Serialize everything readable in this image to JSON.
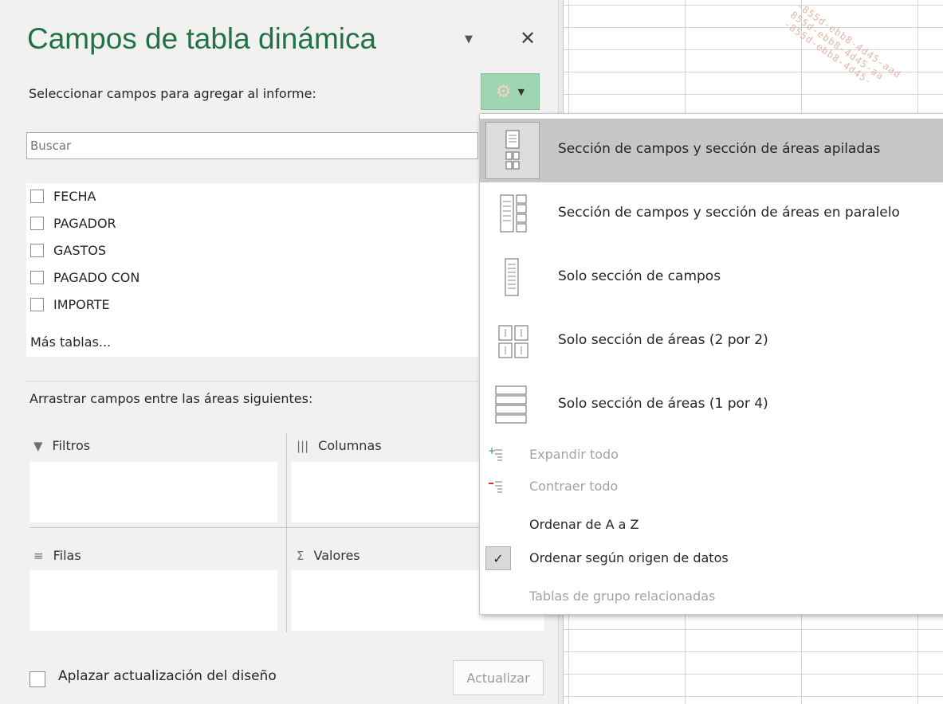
{
  "pane": {
    "title": "Campos de tabla dinámica",
    "select_label": "Seleccionar campos para agregar al informe:",
    "search_placeholder": "Buscar",
    "fields": [
      "FECHA",
      "PAGADOR",
      "GASTOS",
      "PAGADO CON",
      "IMPORTE"
    ],
    "more_tables": "Más tablas...",
    "drag_label": "Arrastrar campos entre las áreas siguientes:",
    "areas": {
      "filters": "Filtros",
      "columns": "Columnas",
      "rows": "Filas",
      "values": "Valores"
    },
    "defer_label": "Aplazar actualización del diseño",
    "update_button": "Actualizar"
  },
  "menu": {
    "layouts": [
      "Sección de campos y sección de áreas apiladas",
      "Sección de campos y sección de áreas en paralelo",
      "Solo sección de campos",
      "Solo sección de áreas (2 por 2)",
      "Solo sección de áreas (1 por 4)"
    ],
    "expand_all": "Expandir todo",
    "collapse_all": "Contraer todo",
    "sort_az": "Ordenar de A a Z",
    "sort_source": "Ordenar según origen de datos",
    "related_groups": "Tablas de grupo relacionadas"
  },
  "colors": {
    "accent_green": "#217346",
    "tools_button": "#9fd5b0"
  }
}
